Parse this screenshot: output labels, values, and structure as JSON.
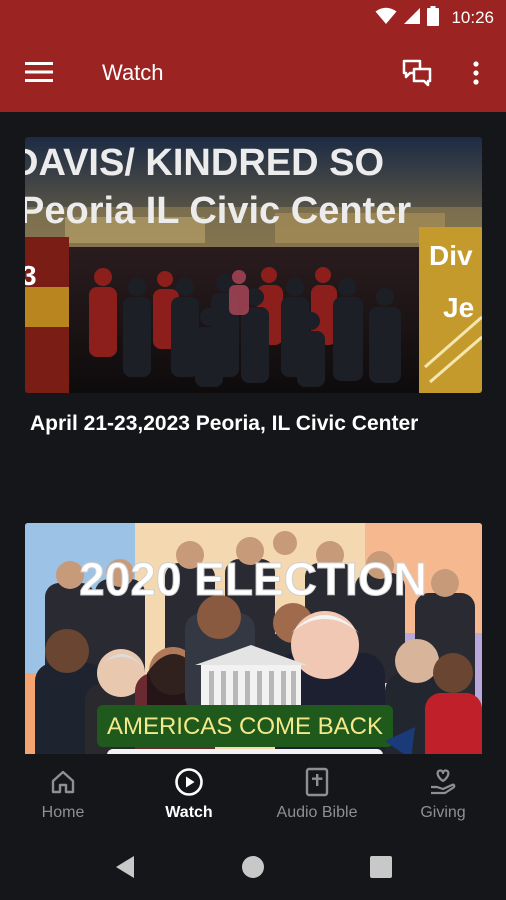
{
  "status_bar": {
    "time": "10:26",
    "icons": [
      "wifi-icon",
      "cell-signal-icon",
      "battery-icon"
    ]
  },
  "app_bar": {
    "title": "Watch",
    "icons": [
      "menu-icon",
      "chat-icon",
      "more-vert-icon"
    ],
    "color": "#9b2321"
  },
  "feed": {
    "items": [
      {
        "thumbnail_text": [
          "DAVIS/ KINDRED SO",
          "Peoria IL Civic Center",
          "Div",
          "Je"
        ],
        "title": "April 21-23,2023 Peoria,  IL Civic Center"
      },
      {
        "thumbnail_text": [
          "2020 ELECTION",
          "AMERICAS COME BACK"
        ],
        "title": ""
      }
    ]
  },
  "bottom_nav": {
    "items": [
      {
        "label": "Home",
        "icon": "home-icon",
        "active": false
      },
      {
        "label": "Watch",
        "icon": "play-circle-icon",
        "active": true
      },
      {
        "label": "Audio Bible",
        "icon": "bible-icon",
        "active": false
      },
      {
        "label": "Giving",
        "icon": "giving-hand-icon",
        "active": false
      }
    ]
  },
  "system_nav": {
    "icons": [
      "back-icon",
      "home-circle-icon",
      "recents-icon"
    ]
  },
  "colors": {
    "background": "#141619",
    "accent": "#9b2321",
    "inactive_nav": "#8d8f92"
  }
}
